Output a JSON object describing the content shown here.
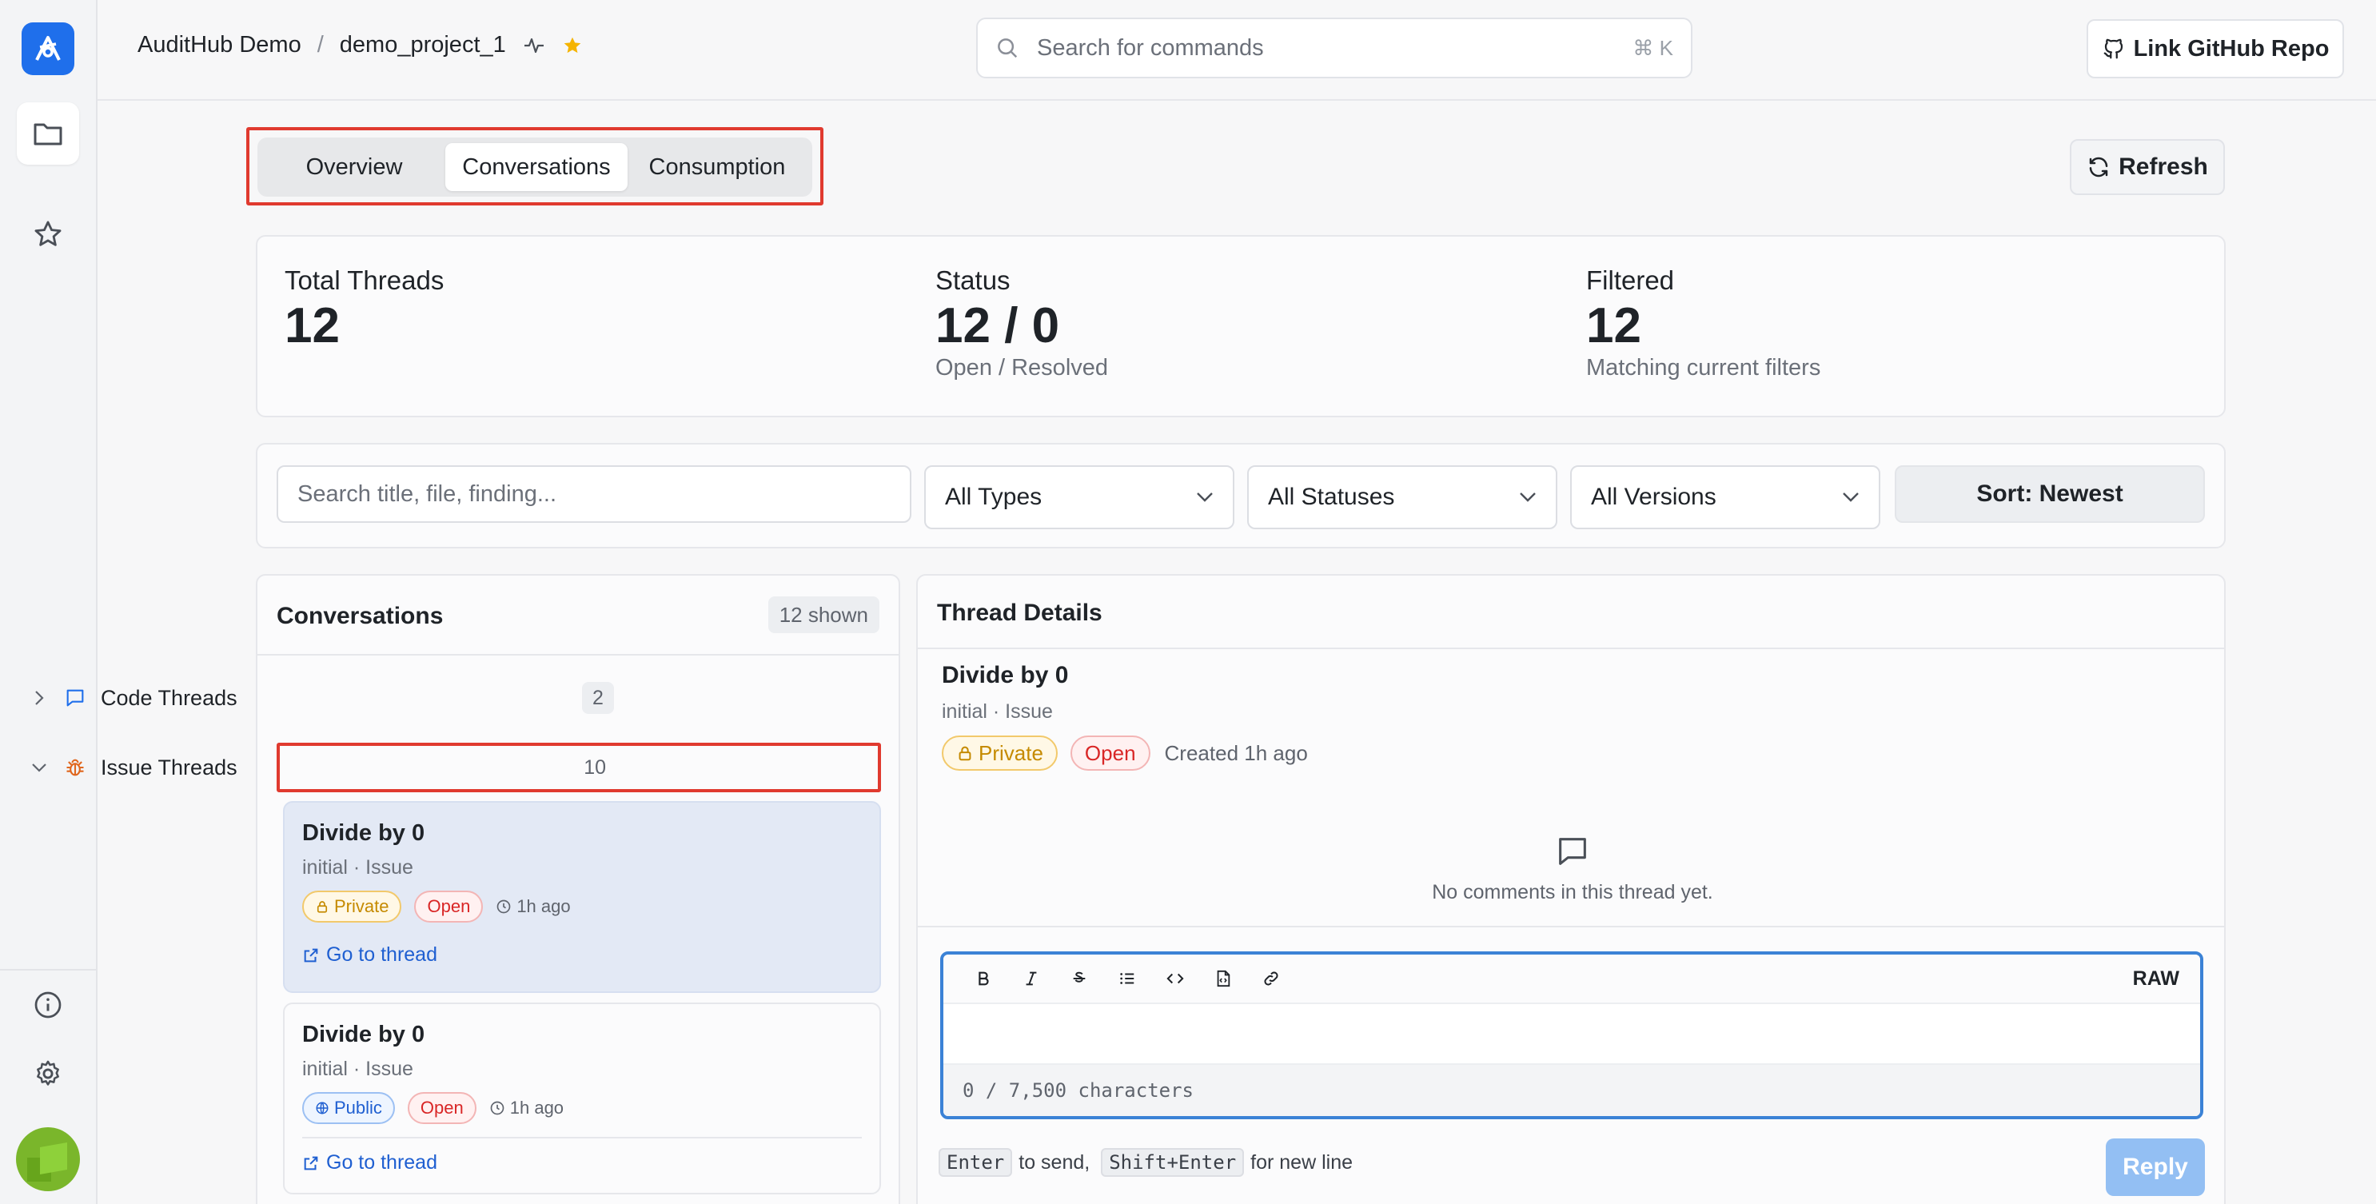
{
  "breadcrumb": {
    "org": "AuditHub Demo",
    "separator": "/",
    "project": "demo_project_1"
  },
  "search": {
    "placeholder": "Search for commands",
    "shortcut": "⌘ K"
  },
  "header": {
    "link_github_label": "Link GitHub Repo"
  },
  "tabs": [
    {
      "label": "Overview",
      "active": false
    },
    {
      "label": "Conversations",
      "active": true
    },
    {
      "label": "Consumption",
      "active": false
    }
  ],
  "refresh_label": "Refresh",
  "stats": {
    "total": {
      "label": "Total Threads",
      "value": "12"
    },
    "status": {
      "label": "Status",
      "value": "12 / 0",
      "sub": "Open / Resolved"
    },
    "filtered": {
      "label": "Filtered",
      "value": "12",
      "sub": "Matching current filters"
    }
  },
  "filters": {
    "search_placeholder": "Search title, file, finding...",
    "types": "All Types",
    "statuses": "All Statuses",
    "versions": "All Versions",
    "sort": "Sort: Newest"
  },
  "conversations": {
    "title": "Conversations",
    "shown": "12 shown",
    "groups": [
      {
        "label": "Code Threads",
        "count": "2",
        "expanded": false
      },
      {
        "label": "Issue Threads",
        "count": "10",
        "expanded": true
      }
    ],
    "cards": [
      {
        "title": "Divide by 0",
        "sub": "initial · Issue",
        "visibility": "Private",
        "status": "Open",
        "time": "1h ago",
        "link": "Go to thread"
      },
      {
        "title": "Divide by 0",
        "sub": "initial · Issue",
        "visibility": "Public",
        "status": "Open",
        "time": "1h ago",
        "link": "Go to thread"
      }
    ]
  },
  "details": {
    "title": "Thread Details",
    "thread_title": "Divide by 0",
    "thread_sub": "initial · Issue",
    "visibility": "Private",
    "status": "Open",
    "created": "Created 1h ago",
    "empty_msg": "No comments in this thread yet.",
    "editor": {
      "raw_label": "RAW",
      "char_count": "0 / 7,500 characters"
    },
    "hint": {
      "enter": "Enter",
      "enter_text": "to send,",
      "shift": "Shift+Enter",
      "shift_text": "for new line"
    },
    "reply_label": "Reply"
  },
  "colors": {
    "accent": "#1f6feb",
    "highlight": "#e03a2f",
    "private": "#c58a00",
    "open": "#d92626",
    "public": "#1f5fd1",
    "star": "#f5b400"
  }
}
